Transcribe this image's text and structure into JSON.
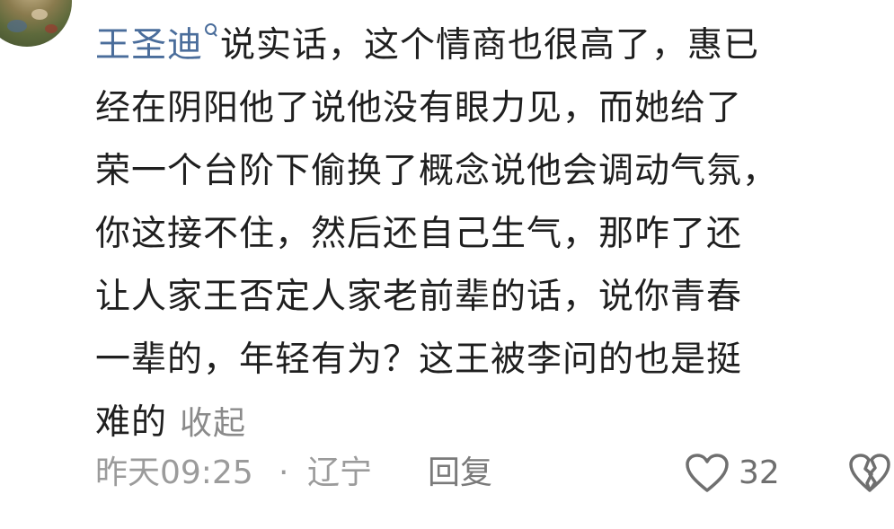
{
  "comment": {
    "username": "王圣迪",
    "lines": [
      "说实话，这个情商也很高了，惠已",
      "经在阴阳他了说他没有眼力见，而她给了",
      "荣一个台阶下偷换了概念说他会调动气氛，",
      "你这接不住，然后还自己生气，那咋了还",
      "让人家王否定人家老前辈的话，说你青春",
      "一辈的，年轻有为？这王被李问的也是挺",
      "难的"
    ],
    "collapse_label": "收起"
  },
  "meta": {
    "time": "昨天09:25",
    "separator": "·",
    "location": "辽宁",
    "reply_label": "回复",
    "like_count": "32"
  },
  "icons": {
    "like": "heart-outline-icon",
    "dislike": "broken-heart-icon",
    "search": "search-icon"
  },
  "colors": {
    "username": "#4a6d9b",
    "text": "#1f1f1f",
    "meta": "#9b9b9b"
  }
}
